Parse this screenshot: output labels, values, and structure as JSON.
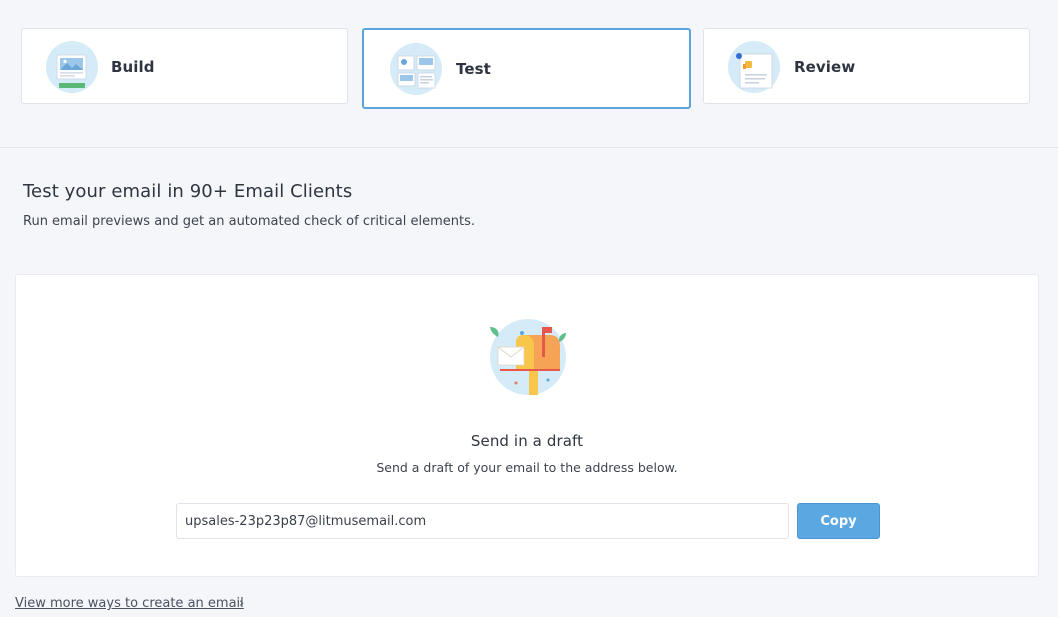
{
  "steps": [
    {
      "label": "Build",
      "icon": "build-illustration-icon",
      "active": false
    },
    {
      "label": "Test",
      "icon": "test-illustration-icon",
      "active": true
    },
    {
      "label": "Review",
      "icon": "review-illustration-icon",
      "active": false
    }
  ],
  "main": {
    "title": "Test your email in 90+ Email Clients",
    "subtitle": "Run email previews and get an automated check of critical elements."
  },
  "draft_card": {
    "icon": "mailbox-illustration-icon",
    "title": "Send in a draft",
    "description": "Send a draft of your email to the address below.",
    "email_value": "upsales-23p23p87@litmusemail.com",
    "copy_label": "Copy"
  },
  "footer": {
    "more_link": "View more ways to create an email",
    "chevron_icon": "chevron-right-icon"
  },
  "colors": {
    "accent": "#5aa7e1",
    "active_border": "#5ba4dc",
    "background": "#f4f6fa"
  }
}
